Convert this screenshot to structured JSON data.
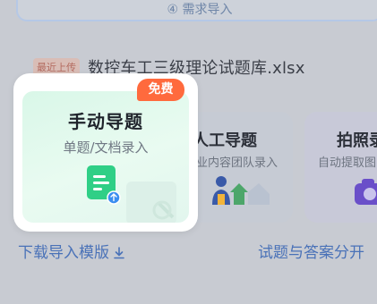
{
  "top": {
    "button_label": "④ 需求导入"
  },
  "recent": {
    "badge": "最近上传",
    "filename": "数控车工三级理论试题库.xlsx"
  },
  "cards": {
    "manual": {
      "title": "手动导题",
      "subtitle": "单题/文档录入",
      "badge": "免费"
    },
    "human": {
      "title": "人工导题",
      "subtitle": "专业内容团队录入"
    },
    "photo": {
      "title": "拍照录",
      "subtitle": "自动提取图"
    }
  },
  "links": {
    "template": "下载导入模版",
    "split": "试题与答案分开"
  },
  "colors": {
    "accent": "#4a72b8",
    "badge": "#ff6a3d",
    "doc_green": "#2fcf86",
    "overlay": "#c8cbd2"
  }
}
